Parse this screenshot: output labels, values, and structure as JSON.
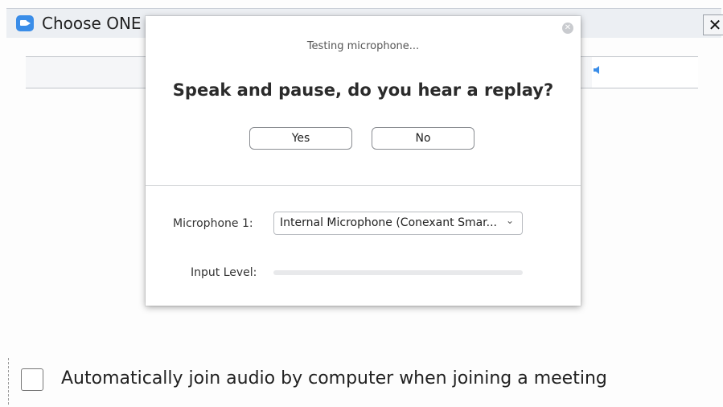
{
  "background_window": {
    "title": "Choose ONE o",
    "close_glyph": "✕",
    "auto_join_label": "Automatically join audio by computer when joining a meeting",
    "auto_join_checked": false
  },
  "dialog": {
    "close_glyph": "✕",
    "status": "Testing microphone...",
    "question": "Speak and pause, do you hear a replay?",
    "yes_label": "Yes",
    "no_label": "No",
    "microphone_label": "Microphone 1:",
    "microphone_value": "Internal Microphone (Conexant Smar...",
    "input_level_label": "Input Level:",
    "input_level": 0
  },
  "colors": {
    "accent": "#2d8cff",
    "app_icon": "#3a8de8"
  },
  "icons": {
    "app": "zoom-app-icon",
    "close": "close-icon",
    "dropdown": "chevron-down-icon",
    "speaker": "speaker-icon"
  }
}
